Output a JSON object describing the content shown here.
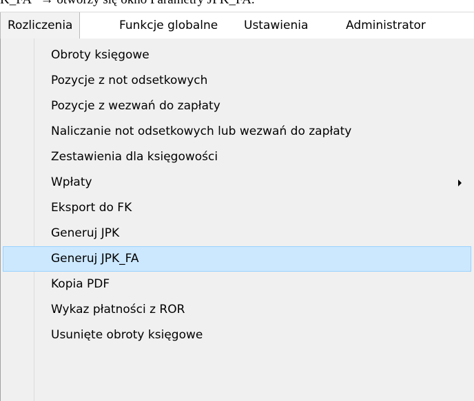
{
  "document_text": "K_FA\" → otworzy się okno Parametry JPK_FA.",
  "menubar": {
    "items": [
      {
        "label": "Rozliczenia",
        "open": true
      },
      {
        "label": "Funkcje globalne"
      },
      {
        "label": "Ustawienia"
      },
      {
        "label": "Administrator"
      }
    ]
  },
  "menu": {
    "items": [
      {
        "label": "Obroty księgowe"
      },
      {
        "label": "Pozycje z not odsetkowych"
      },
      {
        "label": "Pozycje z wezwań do zapłaty"
      },
      {
        "label": "Naliczanie not odsetkowych lub wezwań do zapłaty"
      },
      {
        "label": "Zestawienia dla księgowości"
      },
      {
        "label": "Wpłaty",
        "submenu_icon": "submenu-arrow-icon"
      },
      {
        "label": "Eksport do FK"
      },
      {
        "label": "Generuj JPK"
      },
      {
        "label": "Generuj JPK_FA",
        "highlighted": true
      },
      {
        "label": "Kopia PDF"
      },
      {
        "label": "Wykaz płatności z ROR"
      },
      {
        "label": "Usunięte obroty księgowe"
      }
    ]
  },
  "colors": {
    "menu_background": "#f0f0f0",
    "highlight_fill": "#cce8ff",
    "highlight_border": "#99d1ff"
  }
}
